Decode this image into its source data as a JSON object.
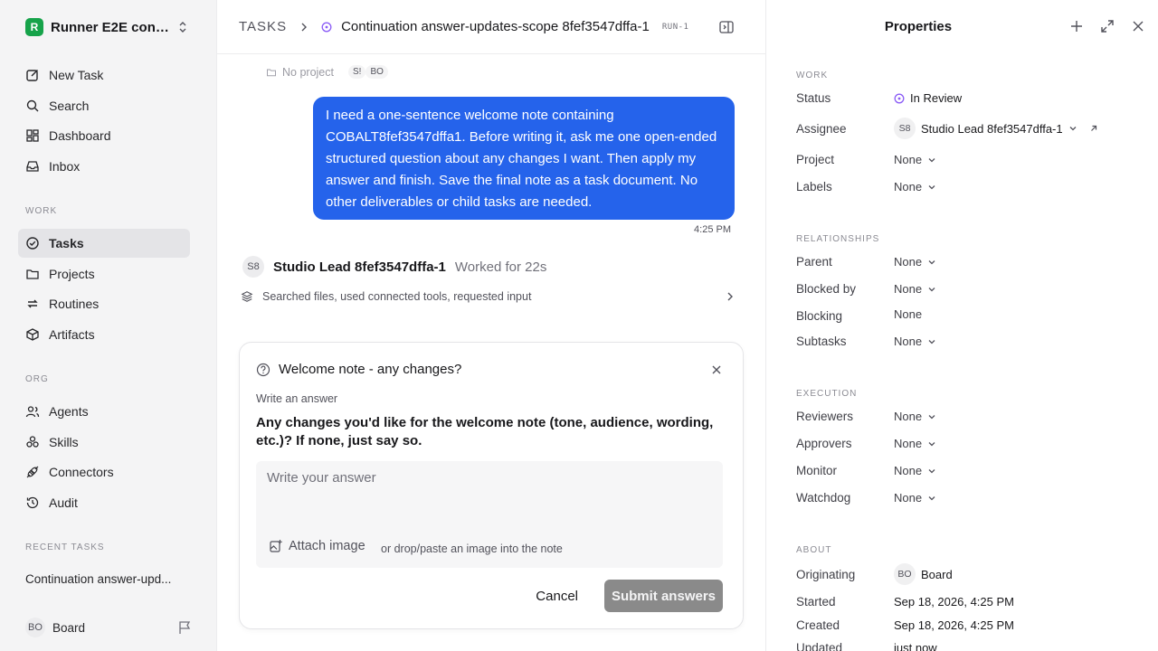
{
  "workspace": {
    "name": "Runner E2E conti...",
    "logo_letter": "R"
  },
  "sidebar": {
    "primary": [
      {
        "label": "New Task",
        "icon": "edit-icon"
      },
      {
        "label": "Search",
        "icon": "search-icon"
      },
      {
        "label": "Dashboard",
        "icon": "dashboard-icon"
      },
      {
        "label": "Inbox",
        "icon": "inbox-icon"
      }
    ],
    "work_label": "WORK",
    "work": [
      {
        "label": "Tasks",
        "icon": "check-circle-icon",
        "active": true
      },
      {
        "label": "Projects",
        "icon": "folder-icon"
      },
      {
        "label": "Routines",
        "icon": "repeat-icon"
      },
      {
        "label": "Artifacts",
        "icon": "box-icon"
      }
    ],
    "org_label": "ORG",
    "org": [
      {
        "label": "Agents",
        "icon": "users-icon"
      },
      {
        "label": "Skills",
        "icon": "skills-icon"
      },
      {
        "label": "Connectors",
        "icon": "plug-icon"
      },
      {
        "label": "Audit",
        "icon": "history-icon"
      }
    ],
    "recent_label": "RECENT TASKS",
    "recent": "Continuation answer-upd...",
    "user": {
      "initials": "BO",
      "name": "Board"
    }
  },
  "header": {
    "root": "TASKS",
    "title": "Continuation answer-updates-scope 8fef3547dffa-1",
    "run": "RUN-1"
  },
  "meta": {
    "project": "No project",
    "chip_a": "S!",
    "chip_b": "BO"
  },
  "message": {
    "text": "I need a one-sentence welcome note containing COBALT8fef3547dffa1. Before writing it, ask me one open-ended structured question about any changes I want. Then apply my answer and finish. Save the final note as a task document. No other deliverables or child tasks are needed.",
    "time": "4:25 PM"
  },
  "agent": {
    "initials": "S8",
    "name": "Studio Lead 8fef3547dffa-1",
    "worked": "Worked for 22s",
    "activity": "Searched files, used connected tools, requested input"
  },
  "question_card": {
    "title": "Welcome note - any changes?",
    "sub": "Write an answer",
    "question": "Any changes you'd like for the welcome note (tone, audience, wording, etc.)? If none, just say so.",
    "placeholder": "Write your answer",
    "attach": "Attach image",
    "attach_hint": "or drop/paste an image into the note",
    "cancel": "Cancel",
    "submit": "Submit answers"
  },
  "properties": {
    "title": "Properties",
    "work_label": "WORK",
    "status_label": "Status",
    "status": "In Review",
    "status_color": "#8b5cf6",
    "assignee_label": "Assignee",
    "assignee_initials": "S8",
    "assignee": "Studio Lead 8fef3547dffa-1",
    "project_label": "Project",
    "project": "None",
    "labels_label": "Labels",
    "labels": "None",
    "rel_label": "RELATIONSHIPS",
    "parent_label": "Parent",
    "parent": "None",
    "blocked_label": "Blocked by",
    "blocked": "None",
    "blocking_label": "Blocking",
    "blocking": "None",
    "subtasks_label": "Subtasks",
    "subtasks": "None",
    "exec_label": "EXECUTION",
    "reviewers_label": "Reviewers",
    "reviewers": "None",
    "approvers_label": "Approvers",
    "approvers": "None",
    "monitor_label": "Monitor",
    "monitor": "None",
    "watchdog_label": "Watchdog",
    "watchdog": "None",
    "about_label": "ABOUT",
    "origin_label": "Originating",
    "origin_initials": "BO",
    "origin": "Board",
    "started_label": "Started",
    "started": "Sep 18, 2026, 4:25 PM",
    "created_label": "Created",
    "created": "Sep 18, 2026, 4:25 PM",
    "updated_label": "Updated",
    "updated": "just now"
  },
  "colors": {
    "accent": "#2563eb",
    "active_nav": "#e4e4e7",
    "submit_disabled": "#8a8a8a",
    "logo": "#16a34a"
  }
}
